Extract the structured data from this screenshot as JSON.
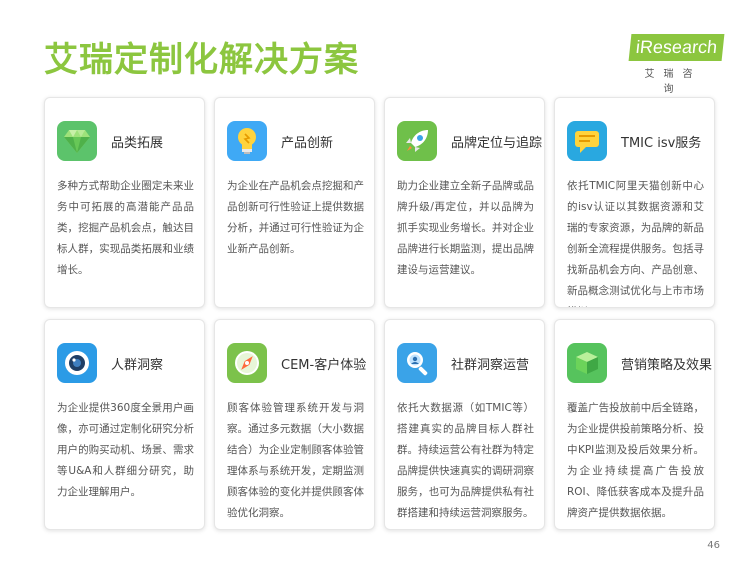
{
  "title": "艾瑞定制化解决方案",
  "logo": {
    "mark": "iResearch",
    "sub": "艾瑞咨询"
  },
  "page_number": "46",
  "cards": [
    {
      "icon": "gem-icon",
      "color": "#5cc36b",
      "title": "品类拓展",
      "desc": "多种方式帮助企业圈定未来业务中可拓展的高潜能产品品类，挖掘产品机会点，触达目标人群，实现品类拓展和业绩增长。"
    },
    {
      "icon": "lightbulb-icon",
      "color": "#3fa9f5",
      "title": "产品创新",
      "desc": "为企业在产品机会点挖掘和产品创新可行性验证上提供数据分析，并通过可行性验证为企业新产品创新。"
    },
    {
      "icon": "rocket-icon",
      "color": "#6fc04a",
      "title": "品牌定位与追踪",
      "desc": "助力企业建立全新子品牌或品牌升级/再定位，并以品牌为抓手实现业务增长。并对企业品牌进行长期监测，提出品牌建设与运营建议。"
    },
    {
      "icon": "chat-icon",
      "color": "#29a8e0",
      "title": "TMIC isv服务",
      "desc": "依托TMIC阿里天猫创新中心的isv认证以其数据资源和艾瑞的专家资源，为品牌的新品创新全流程提供服务。包括寻找新品机会方向、产品创意、新品概念测试优化与上市市场模拟。"
    },
    {
      "icon": "camera-icon",
      "color": "#2b9be6",
      "title": "人群洞察",
      "desc": "为企业提供360度全景用户画像，亦可通过定制化研究分析用户的购买动机、场景、需求等U&A和人群细分研究，助力企业理解用户。"
    },
    {
      "icon": "compass-icon",
      "color": "#7cc24b",
      "title": "CEM-客户体验",
      "desc": "顾客体验管理系统开发与洞察。通过多元数据（大小数据结合）为企业定制顾客体验管理体系与系统开发，定期监测顾客体验的变化并提供顾客体验优化洞察。"
    },
    {
      "icon": "magnifier-icon",
      "color": "#3aa3e8",
      "title": "社群洞察运营",
      "desc": "依托大数据源（如TMIC等）搭建真实的品牌目标人群社群。持续运营公有社群为特定品牌提供快速真实的调研洞察服务，也可为品牌提供私有社群搭建和持续运营洞察服务。"
    },
    {
      "icon": "cube-icon",
      "color": "#56c35d",
      "title": "营销策略及效果",
      "desc": "覆盖广告投放前中后全链路，为企业提供投前策略分析、投中KPI监测及投后效果分析。为企业持续提高广告投放ROI、降低获客成本及提升品牌资产提供数据依据。"
    }
  ]
}
